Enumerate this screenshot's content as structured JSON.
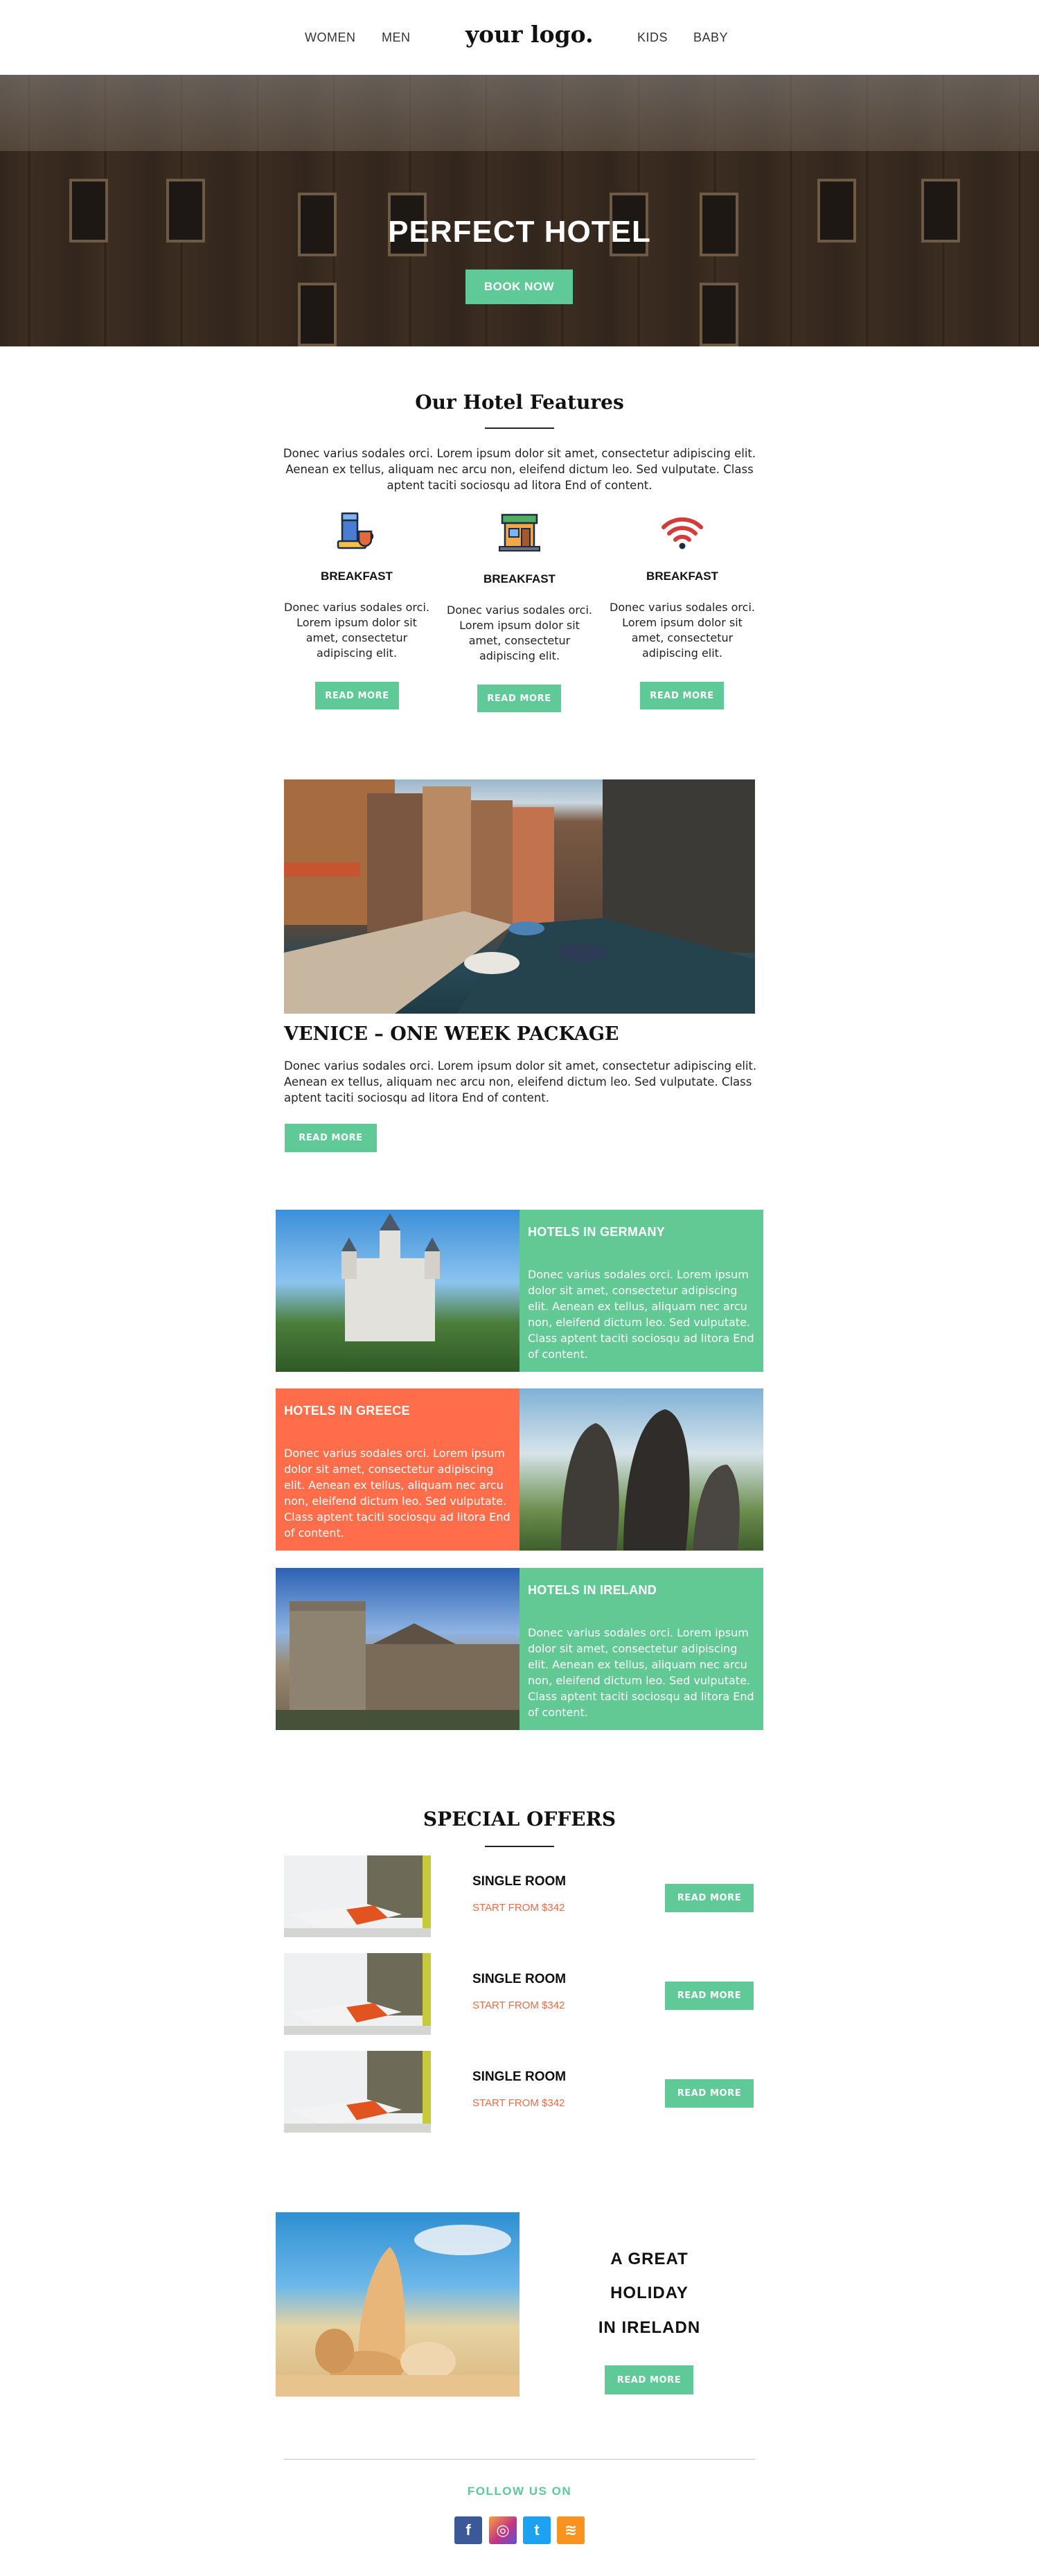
{
  "header": {
    "nav_left": [
      "WOMEN",
      "MEN"
    ],
    "logo": "your logo.",
    "nav_right": [
      "KIDS",
      "BABY"
    ]
  },
  "hero": {
    "title": "PERFECT HOTEL",
    "button": "BOOK NOW"
  },
  "features": {
    "title": "Our Hotel Features",
    "intro": "Donec varius sodales orci. Lorem ipsum dolor sit amet, consectetur adipiscing elit. Aenean ex tellus, aliquam nec arcu non, eleifend dictum leo. Sed vulputate. Class aptent taciti sociosqu ad litora End of content.",
    "items": [
      {
        "icon": "breakfast-icon",
        "title": "BREAKFAST",
        "text": "Donec varius sodales orci. Lorem ipsum dolor sit amet, consectetur adipiscing elit.",
        "button": "READ MORE"
      },
      {
        "icon": "shop-icon",
        "title": "BREAKFAST",
        "text": "Donec varius sodales orci. Lorem ipsum dolor sit amet, consectetur adipiscing elit.",
        "button": "READ MORE"
      },
      {
        "icon": "wifi-icon",
        "title": "BREAKFAST",
        "text": "Donec varius sodales orci. Lorem ipsum dolor sit amet, consectetur adipiscing elit.",
        "button": "READ MORE"
      }
    ]
  },
  "venice": {
    "title": "VENICE – ONE WEEK PACKAGE",
    "text": "Donec varius sodales orci. Lorem ipsum dolor sit amet, consectetur adipiscing elit. Aenean ex tellus, aliquam nec arcu non, eleifend dictum leo. Sed vulputate. Class aptent taciti sociosqu ad litora End of content.",
    "button": "READ MORE"
  },
  "hotels": [
    {
      "title": "HOTELS IN GERMANY",
      "text": "Donec varius sodales orci. Lorem ipsum dolor sit amet, consectetur adipiscing elit. Aenean ex tellus, aliquam nec arcu non, eleifend dictum leo. Sed vulputate. Class aptent taciti sociosqu ad litora End of content."
    },
    {
      "title": "HOTELS IN GREECE",
      "text": "Donec varius sodales orci. Lorem ipsum dolor sit amet, consectetur adipiscing elit. Aenean ex tellus, aliquam nec arcu non, eleifend dictum leo. Sed vulputate. Class aptent taciti sociosqu ad litora End of content."
    },
    {
      "title": "HOTELS IN IRELAND",
      "text": "Donec varius sodales orci. Lorem ipsum dolor sit amet, consectetur adipiscing elit. Aenean ex tellus, aliquam nec arcu non, eleifend dictum leo. Sed vulputate. Class aptent taciti sociosqu ad litora End of content."
    }
  ],
  "offers": {
    "title": "SPECIAL OFFERS",
    "items": [
      {
        "title": "SINGLE ROOM",
        "price": "START FROM $342",
        "button": "READ MORE"
      },
      {
        "title": "SINGLE ROOM",
        "price": "START FROM $342",
        "button": "READ MORE"
      },
      {
        "title": "SINGLE ROOM",
        "price": "START FROM $342",
        "button": "READ MORE"
      }
    ]
  },
  "holiday": {
    "lines": [
      "A GREAT",
      "HOLIDAY",
      "IN IRELADN"
    ],
    "button": "READ MORE"
  },
  "footer": {
    "follow": "FOLLOW  US  ON",
    "social": [
      {
        "icon": "facebook-icon",
        "glyph": "f",
        "color": "#3b5998"
      },
      {
        "icon": "instagram-icon",
        "glyph": "◎",
        "color": "#c13584"
      },
      {
        "icon": "twitter-icon",
        "glyph": "t",
        "color": "#1da1f2"
      },
      {
        "icon": "rss-icon",
        "glyph": "≋",
        "color": "#f7931e"
      }
    ]
  },
  "colors": {
    "accent_green": "#5fc997",
    "accent_orange": "#ff6d4a",
    "price_orange": "#ef6a43"
  }
}
